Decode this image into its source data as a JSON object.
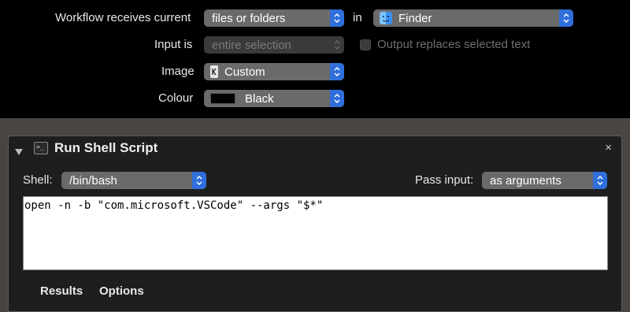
{
  "config": {
    "receives_label": "Workflow receives current",
    "receives_value": "files or folders",
    "in_label": "in",
    "app_value": "Finder",
    "input_label": "Input is",
    "input_value": "entire selection",
    "output_replaces_label": "Output replaces selected text",
    "image_label": "Image",
    "image_value": "Custom",
    "colour_label": "Colour",
    "colour_value": "Black",
    "colour_swatch": "#000000"
  },
  "action": {
    "title": "Run Shell Script",
    "close_glyph": "×",
    "shell_label": "Shell:",
    "shell_value": "/bin/bash",
    "pass_input_label": "Pass input:",
    "pass_input_value": "as arguments",
    "script": "open -n -b \"com.microsoft.VSCode\" --args \"$*\"",
    "tabs": [
      "Results",
      "Options"
    ]
  },
  "colors": {
    "accent": "#2f6fdc",
    "panel_bg": "#1e1e1e",
    "workspace_bg": "#4a4541"
  }
}
